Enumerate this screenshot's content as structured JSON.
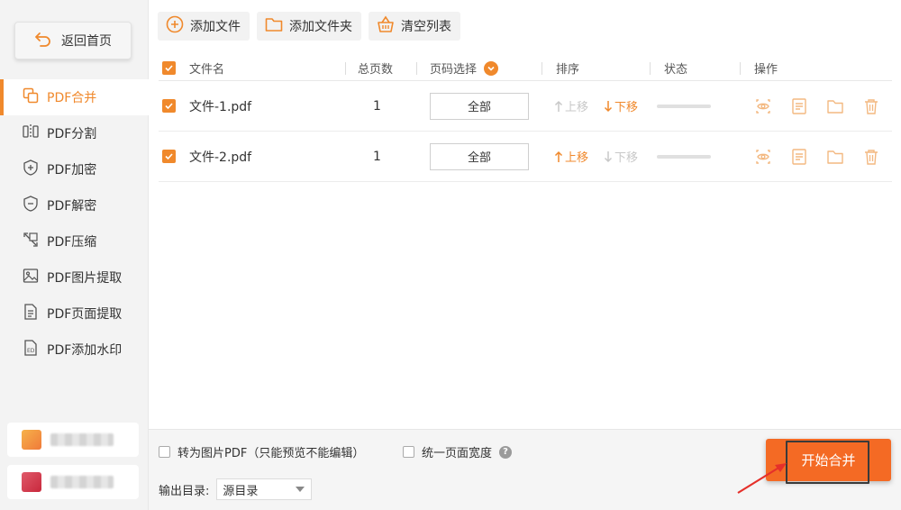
{
  "sidebar": {
    "back_label": "返回首页",
    "items": [
      {
        "label": "PDF合并",
        "icon": "merge-icon",
        "active": true
      },
      {
        "label": "PDF分割",
        "icon": "split-icon"
      },
      {
        "label": "PDF加密",
        "icon": "shield-plus-icon"
      },
      {
        "label": "PDF解密",
        "icon": "shield-minus-icon"
      },
      {
        "label": "PDF压缩",
        "icon": "compress-icon"
      },
      {
        "label": "PDF图片提取",
        "icon": "image-icon"
      },
      {
        "label": "PDF页面提取",
        "icon": "page-icon"
      },
      {
        "label": "PDF添加水印",
        "icon": "watermark-icon"
      }
    ]
  },
  "toolbar": {
    "add_file": "添加文件",
    "add_folder": "添加文件夹",
    "clear_list": "清空列表"
  },
  "table": {
    "headers": {
      "filename": "文件名",
      "pages": "总页数",
      "page_select": "页码选择",
      "sort": "排序",
      "status": "状态",
      "actions": "操作"
    },
    "rows": [
      {
        "filename": "文件-1.pdf",
        "pages": "1",
        "page_select": "全部",
        "up": "上移",
        "down": "下移",
        "up_enabled": false,
        "down_enabled": true
      },
      {
        "filename": "文件-2.pdf",
        "pages": "1",
        "page_select": "全部",
        "up": "上移",
        "down": "下移",
        "up_enabled": true,
        "down_enabled": false
      }
    ]
  },
  "bottom": {
    "to_image_pdf": "转为图片PDF（只能预览不能编辑）",
    "uniform_width": "统一页面宽度",
    "help": "?",
    "output_dir_label": "输出目录:",
    "output_dir_value": "源目录",
    "start_button": "开始合并"
  },
  "colors": {
    "accent": "#f0892c",
    "start_button": "#f46a24",
    "annotation_arrow": "#e5302a"
  }
}
